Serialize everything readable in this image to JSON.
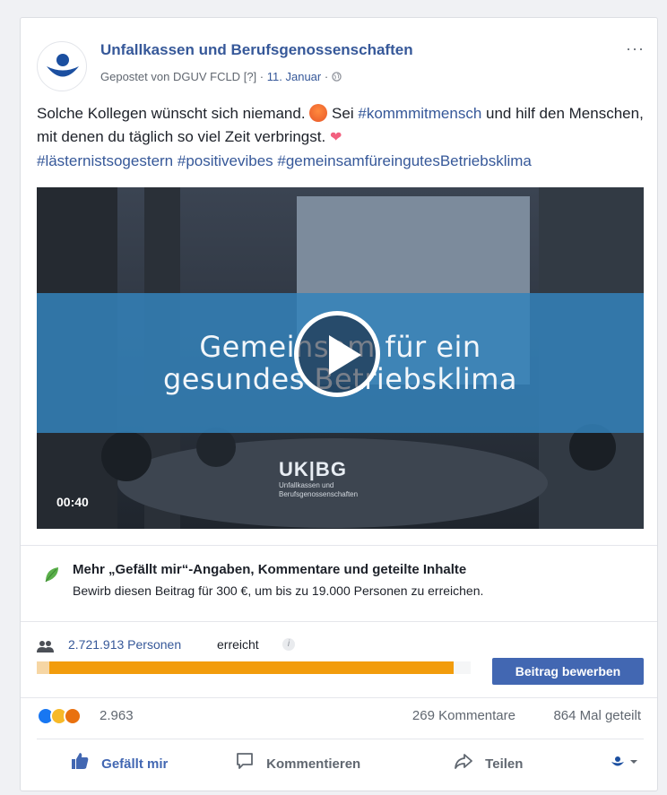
{
  "post": {
    "page_name": "Unfallkassen und Berufsgenossenschaften",
    "posted_by_prefix": "Gepostet von",
    "posted_by": "DGUV FCLD",
    "posted_by_suffix": "[?]",
    "separator": "·",
    "date": "11. Januar",
    "more": "···",
    "text_part1": "Solche Kollegen wünscht sich niemand.",
    "text_part2": "Sei",
    "hashtag1": "#kommmitmensch",
    "text_part3": "und hilf den Menschen, mit denen du täglich so viel Zeit verbringst.",
    "hashtag2": "#lästernistsogestern",
    "hashtag3": "#positivevibes",
    "hashtag4": "#gemeinsamfüreingutesBetriebsklima"
  },
  "video": {
    "title_line1": "Gemeinsam für ein",
    "title_line2": "gesundes Betriebsklima",
    "brand": "UK|BG",
    "brand_sub1": "Unfallkassen und",
    "brand_sub2": "Berufsgenossenschaften",
    "duration": "00:40"
  },
  "boost": {
    "title": "Mehr „Gefällt mir“-Angaben, Kommentare und geteilte Inhalte",
    "subtitle": "Bewirb diesen Beitrag für 300 €, um bis zu 19.000 Personen zu erreichen."
  },
  "reach": {
    "count": "2.721.913 Personen",
    "label": "erreicht",
    "info": "i",
    "progress_fraction": 0.96,
    "button": "Beitrag bewerben"
  },
  "stats": {
    "reactions": "2.963",
    "comments": "269 Kommentare",
    "shares": "864 Mal geteilt"
  },
  "actions": {
    "like": "Gefällt mir",
    "comment": "Kommentieren",
    "share": "Teilen"
  },
  "colors": {
    "link": "#365899",
    "primary_button": "#4267b2",
    "progress": "#f29c0c"
  }
}
